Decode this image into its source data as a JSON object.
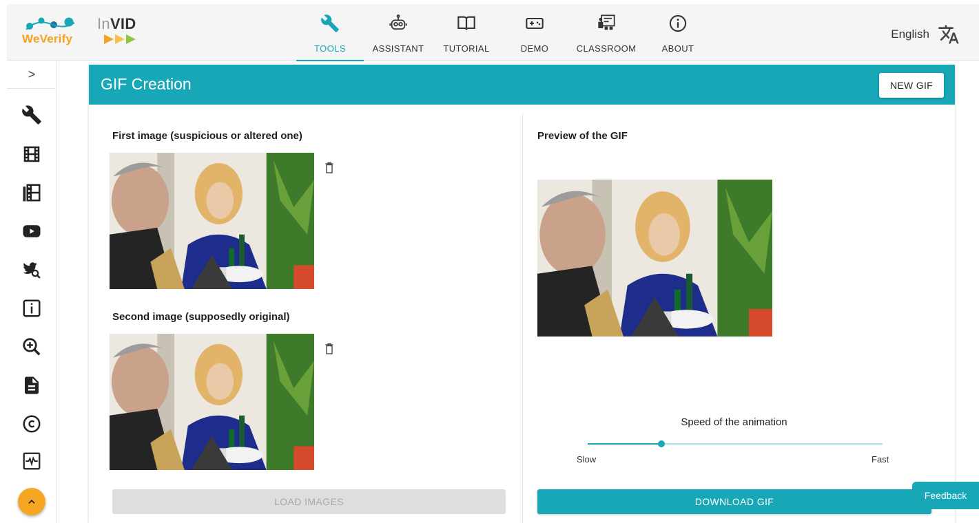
{
  "brand": {
    "weverify_name": "WeVerify",
    "invid_prefix": "In",
    "invid_suffix": "VID"
  },
  "nav": {
    "tabs": [
      {
        "label": "TOOLS",
        "icon": "wrench-icon",
        "active": true
      },
      {
        "label": "ASSISTANT",
        "icon": "robot-icon",
        "active": false
      },
      {
        "label": "TUTORIAL",
        "icon": "book-icon",
        "active": false
      },
      {
        "label": "DEMO",
        "icon": "gamepad-icon",
        "active": false
      },
      {
        "label": "CLASSROOM",
        "icon": "classroom-icon",
        "active": false
      },
      {
        "label": "ABOUT",
        "icon": "info-icon",
        "active": false
      }
    ],
    "language": "English"
  },
  "sidebar": {
    "expand_glyph": ">",
    "icons": [
      "wrench-icon",
      "film-icon",
      "film-stack-icon",
      "youtube-icon",
      "twitter-search-icon",
      "info-box-icon",
      "zoom-in-icon",
      "document-icon",
      "copyright-icon",
      "pulse-icon"
    ]
  },
  "card": {
    "title": "GIF Creation",
    "new_gif_label": "NEW GIF"
  },
  "left": {
    "first_image_label": "First image (suspicious or altered one)",
    "second_image_label": "Second image (supposedly original)",
    "load_button_label": "LOAD IMAGES"
  },
  "right": {
    "preview_label": "Preview of the GIF",
    "speed_label": "Speed of the animation",
    "slow_label": "Slow",
    "fast_label": "Fast",
    "speed_value_fraction": 0.25,
    "download_button_label": "DOWNLOAD GIF"
  },
  "feedback_label": "Feedback",
  "colors": {
    "accent": "#17a7b7",
    "weverify_orange": "#f3a31f",
    "scroll_button": "#f5a623"
  }
}
